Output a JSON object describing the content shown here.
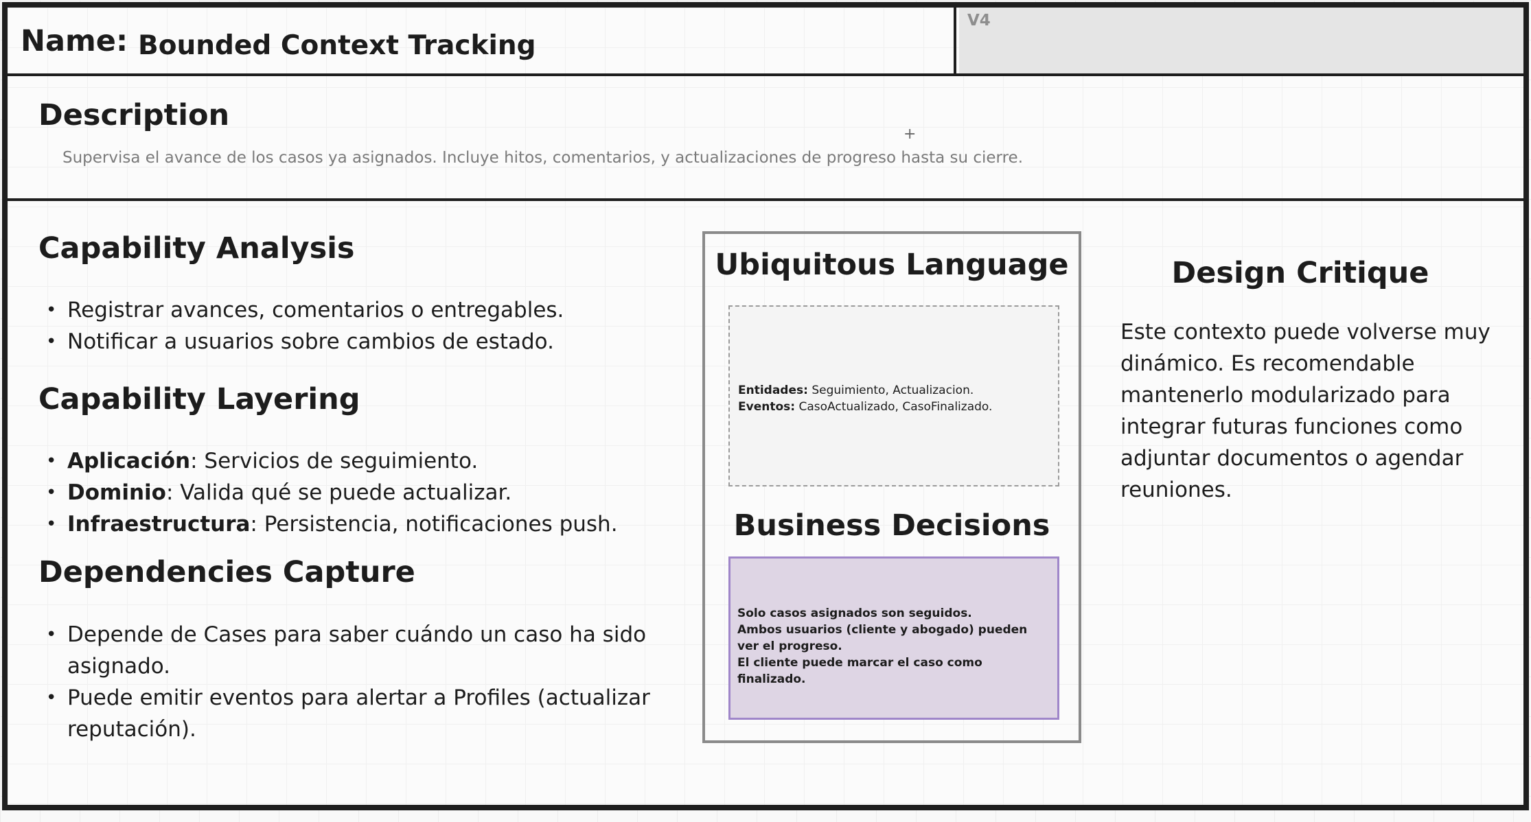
{
  "name": {
    "label": "Name:",
    "value": "Bounded Context Tracking",
    "version": "V4"
  },
  "description": {
    "title": "Description",
    "text": "Supervisa el avance de los casos ya asignados. Incluye hitos, comentarios, y actualizaciones de progreso hasta su cierre.",
    "plus": "+"
  },
  "capability_analysis": {
    "title": "Capability Analysis",
    "items": [
      "Registrar avances, comentarios o entregables.",
      "Notificar a usuarios sobre cambios de estado."
    ]
  },
  "capability_layering": {
    "title": "Capability Layering",
    "items": [
      {
        "term": "Aplicación",
        "text": ": Servicios de seguimiento."
      },
      {
        "term": "Dominio",
        "text": ": Valida qué se puede actualizar."
      },
      {
        "term": "Infraestructura",
        "text": ": Persistencia, notificaciones push."
      }
    ]
  },
  "dependencies_capture": {
    "title": "Dependencies Capture",
    "items": [
      "Depende de Cases para saber cuándo un caso ha sido asignado.",
      "Puede emitir eventos para alertar a Profiles (actualizar reputación)."
    ]
  },
  "ubiquitous_language": {
    "title": "Ubiquitous Language",
    "entities_label": "Entidades:",
    "entities_value": " Seguimiento, Actualizacion.",
    "events_label": "Eventos:",
    "events_value": " CasoActualizado, CasoFinalizado."
  },
  "business_decisions": {
    "title": "Business Decisions",
    "lines": [
      "Solo casos asignados son seguidos.",
      "Ambos usuarios (cliente y abogado) pueden ver el progreso.",
      "El cliente puede marcar el caso como finalizado."
    ]
  },
  "design_critique": {
    "title": "Design Critique",
    "text": "Este contexto puede volverse muy dinámico. Es recomendable mantenerlo modularizado para integrar futuras funciones como adjuntar documentos o agendar reuniones."
  },
  "colors": {
    "frame": "#1e1e1e",
    "business_fill": "#ded5e4",
    "business_border": "#9f86c9",
    "version_fill": "#e5e5e5"
  }
}
